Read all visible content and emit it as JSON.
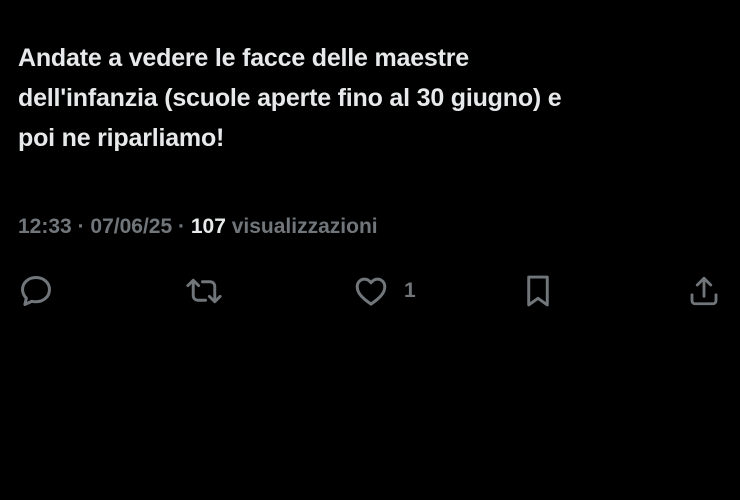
{
  "tweet": {
    "text_lines": [
      "Andate a vedere le facce delle maestre",
      "dell'infanzia (scuole aperte fino al 30 giugno) e",
      "poi ne riparliamo!"
    ],
    "time": "12:33",
    "date": "07/06/25",
    "separator": "·",
    "views_count": "107",
    "views_label": "visualizzazioni"
  },
  "actions": {
    "reply": {
      "icon": "reply-icon",
      "count": ""
    },
    "retweet": {
      "icon": "retweet-icon",
      "count": ""
    },
    "like": {
      "icon": "heart-icon",
      "count": "1"
    },
    "bookmark": {
      "icon": "bookmark-icon",
      "count": ""
    },
    "share": {
      "icon": "share-icon",
      "count": ""
    }
  },
  "colors": {
    "background": "#000000",
    "text": "#e7e9ea",
    "muted": "#71767b"
  }
}
